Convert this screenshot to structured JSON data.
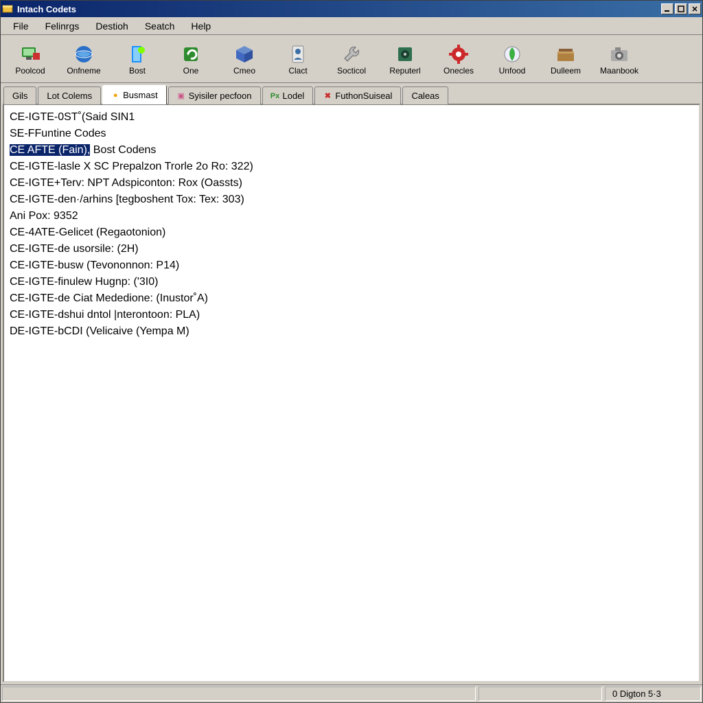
{
  "window": {
    "title": "Intach Codets"
  },
  "menu": {
    "items": [
      {
        "label": "File"
      },
      {
        "label": "Felinrgs"
      },
      {
        "label": "Destioh"
      },
      {
        "label": "Seatch"
      },
      {
        "label": "Help"
      }
    ]
  },
  "toolbar": {
    "buttons": [
      {
        "label": "Poolcod",
        "icon": "monitor-icon",
        "color": "#2e8b2e"
      },
      {
        "label": "Onfneme",
        "icon": "globe-icon",
        "color": "#2a70c8"
      },
      {
        "label": "Bost",
        "icon": "door-icon",
        "color": "#1e90ff"
      },
      {
        "label": "One",
        "icon": "refresh-icon",
        "color": "#2e8b2e"
      },
      {
        "label": "Cmeo",
        "icon": "box-icon",
        "color": "#4169c0"
      },
      {
        "label": "Clact",
        "icon": "person-icon",
        "color": "#3a6ea5"
      },
      {
        "label": "Socticol",
        "icon": "wrench-icon",
        "color": "#777"
      },
      {
        "label": "Reputerl",
        "icon": "safe-icon",
        "color": "#2f6f4f"
      },
      {
        "label": "Onecles",
        "icon": "gear-red-icon",
        "color": "#cc2a2a"
      },
      {
        "label": "Unfood",
        "icon": "leaf-icon",
        "color": "#3cb043"
      },
      {
        "label": "Dulleem",
        "icon": "folder-icon",
        "color": "#b08040"
      },
      {
        "label": "Maanbook",
        "icon": "camera-icon",
        "color": "#888"
      }
    ]
  },
  "tabs": {
    "items": [
      {
        "label": "Gils",
        "icon": "",
        "iconColor": ""
      },
      {
        "label": "Lot Colems",
        "icon": "",
        "iconColor": ""
      },
      {
        "label": "Busmast",
        "icon": "●",
        "iconColor": "#f0a000",
        "active": true
      },
      {
        "label": "Syisiler pecfoon",
        "icon": "▣",
        "iconColor": "#cc5588"
      },
      {
        "label": "Lodel",
        "icon": "Px",
        "iconColor": "#2e8b2e"
      },
      {
        "label": "FuthonSuiseal",
        "icon": "✖",
        "iconColor": "#cc2a2a"
      },
      {
        "label": "Caleas",
        "icon": "",
        "iconColor": ""
      }
    ]
  },
  "content": {
    "lines": [
      {
        "text": "CE-IGTE-0ST˚(Said SIN1"
      },
      {
        "text": "SE-FFuntine Codes"
      },
      {
        "selected": true,
        "selPrefix": "CE AFTE (Fain),",
        "rest": " Bost Codens"
      },
      {
        "text": "CE-IGTE-lasle X SC Prepalzon Trorle 2o Ro: 322)"
      },
      {
        "text": "CE-IGTE+Terv: NPT Adspiconton: Rox (Oassts)"
      },
      {
        "text": "CE-IGTE-den·/arhins [tegboshent Tox: Tex: 303)"
      },
      {
        "text": "Ani Pox: 9352"
      },
      {
        "text": "CE-4ATE-Gelicet (Regaotonion)"
      },
      {
        "text": "CE-IGTE-de usorsile: (2H)"
      },
      {
        "text": "CE-IGTE-busw (Tevononnon: P14)"
      },
      {
        "text": "CE-IGTE-finulew Hugnp: ('3I0)"
      },
      {
        "text": "CE-IGTE-de Ciat Mededione: (Inustor˚A)"
      },
      {
        "text": "CE-IGTE-dshui dntol |nterontoon: PLA)"
      },
      {
        "text": "DE-IGTE-bCDI (Velicaive (Yempa M)"
      }
    ]
  },
  "status": {
    "left": "",
    "right": "0 Digton 5·3"
  }
}
